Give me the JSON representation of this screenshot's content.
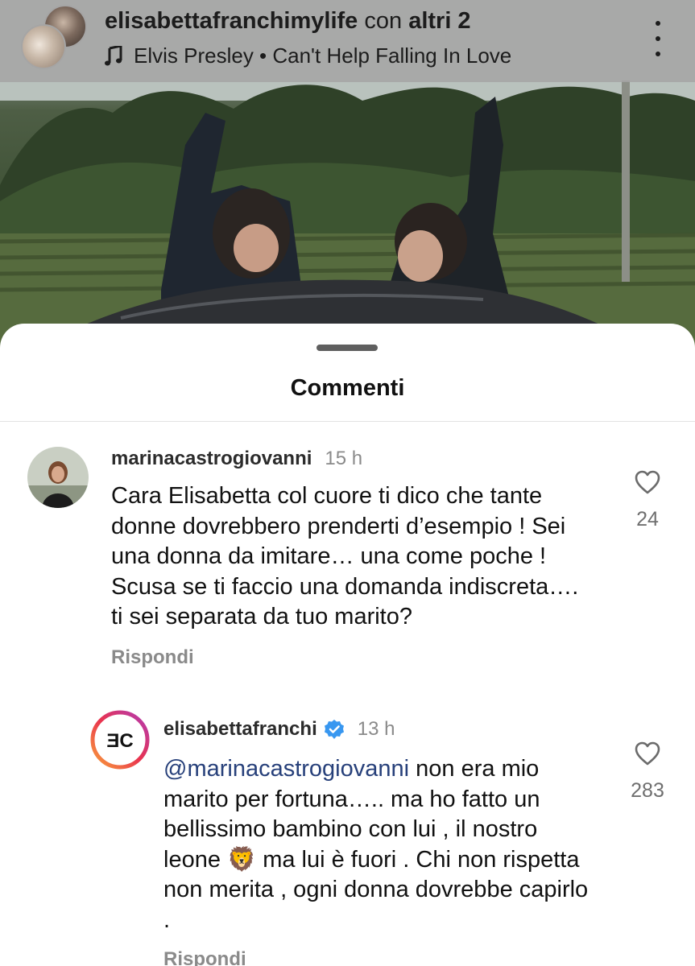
{
  "post_header": {
    "owner": "elisabettafranchimylife",
    "with_text": "con",
    "others": "altri 2",
    "music_icon": "music-note-icon",
    "song": "Elvis Presley • Can't Help Falling In Love",
    "menu_icon": "more-vertical-icon"
  },
  "sheet": {
    "title": "Commenti"
  },
  "comments": [
    {
      "username": "marinacastrogiovanni",
      "time": "15 h",
      "text": "Cara Elisabetta col cuore ti dico che tante donne dovrebbero prenderti d’esempio ! Sei una donna da imitare… una come poche ! Scusa se ti faccio una domanda indiscreta…. ti sei separata da tuo marito?",
      "likes": "24",
      "reply_label": "Rispondi"
    },
    {
      "username": "elisabettafranchi",
      "verified": true,
      "time": "13 h",
      "mention": "@marinacastrogiovanni",
      "text_before_emoji": " non era mio marito per fortuna….. ma ho fatto un bellissimo bambino con lui , il nostro leone",
      "emoji": "🦁",
      "text_after_emoji": " ma lui è fuori . Chi non rispetta non merita , ogni donna dovrebbe capirlo .",
      "likes": "283",
      "reply_label": "Rispondi",
      "avatar_logo_text": "ƎC"
    }
  ],
  "colors": {
    "mention": "#27407a",
    "verified": "#3897f0",
    "meta_gray": "#8a8a8a"
  }
}
